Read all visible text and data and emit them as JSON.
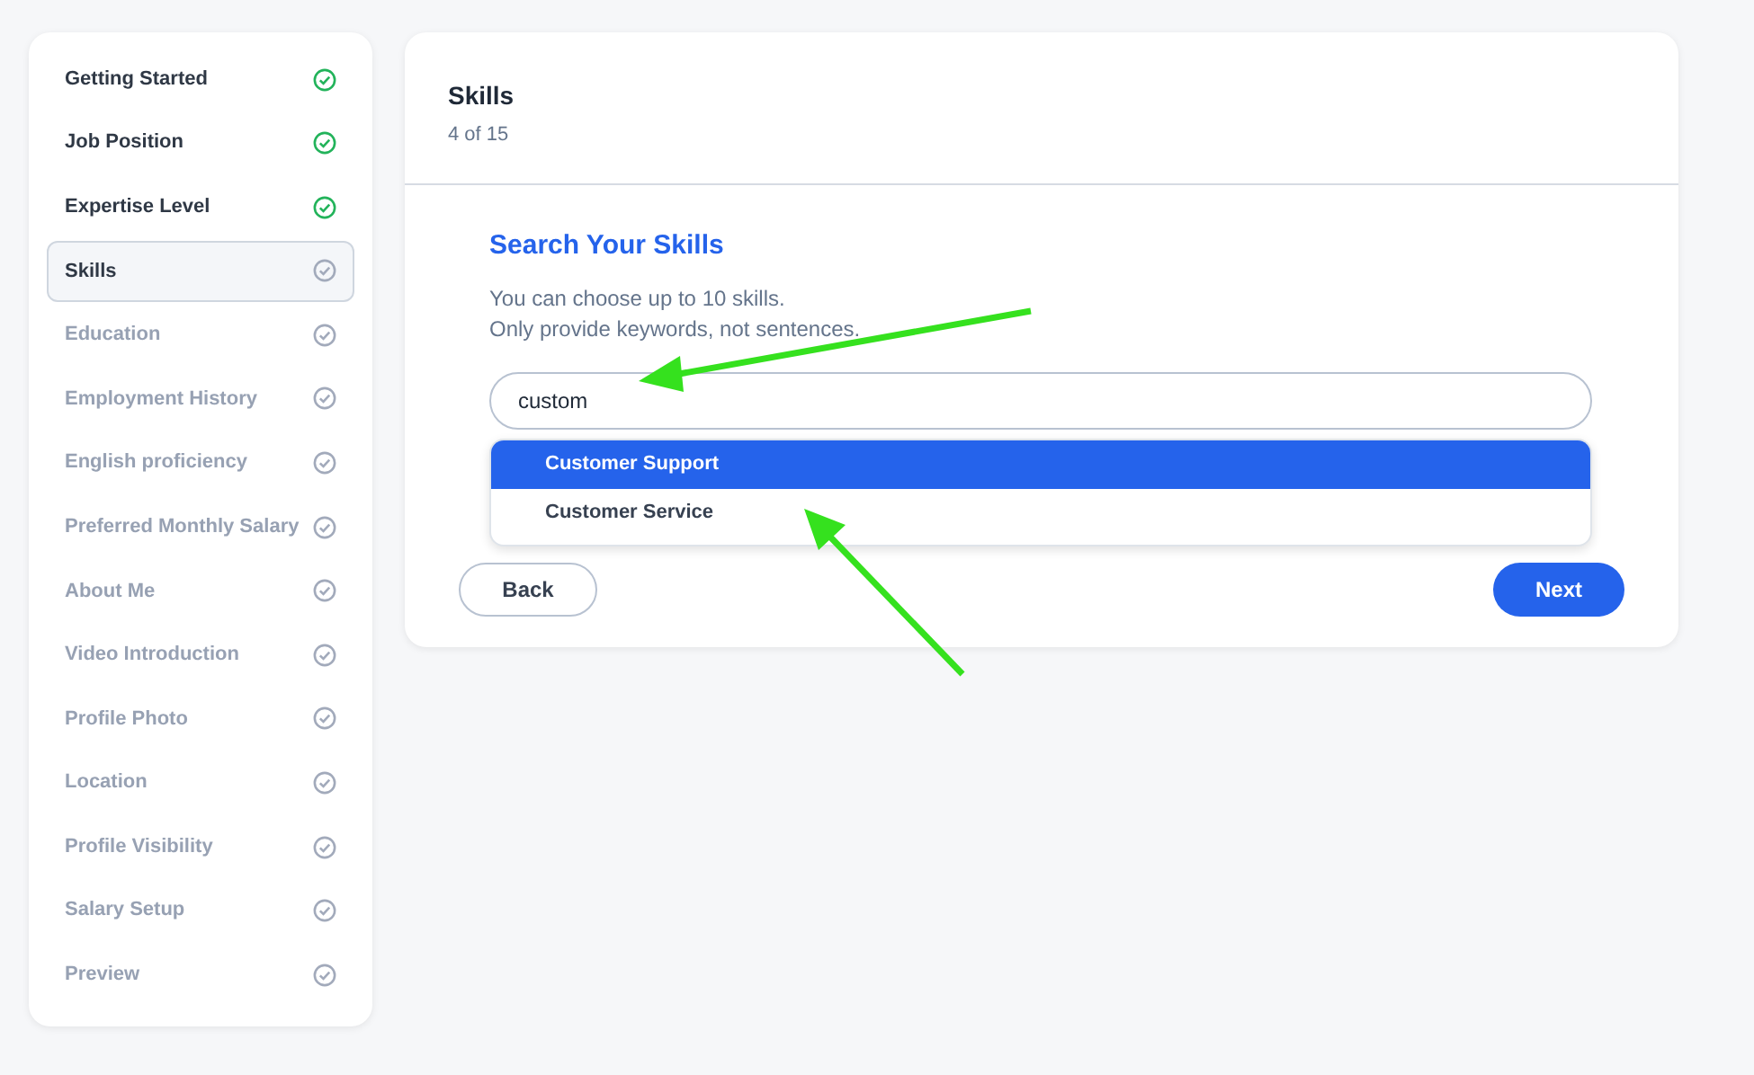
{
  "steps": [
    {
      "label": "Getting Started",
      "completed": true,
      "selected": false
    },
    {
      "label": "Job Position",
      "completed": true,
      "selected": false
    },
    {
      "label": "Expertise Level",
      "completed": true,
      "selected": false
    },
    {
      "label": "Skills",
      "completed": false,
      "selected": true
    },
    {
      "label": "Education",
      "completed": false,
      "selected": false
    },
    {
      "label": "Employment History",
      "completed": false,
      "selected": false
    },
    {
      "label": "English proficiency",
      "completed": false,
      "selected": false
    },
    {
      "label": "Preferred Monthly Salary",
      "completed": false,
      "selected": false
    },
    {
      "label": "About Me",
      "completed": false,
      "selected": false
    },
    {
      "label": "Video Introduction",
      "completed": false,
      "selected": false
    },
    {
      "label": "Profile Photo",
      "completed": false,
      "selected": false
    },
    {
      "label": "Location",
      "completed": false,
      "selected": false
    },
    {
      "label": "Profile Visibility",
      "completed": false,
      "selected": false
    },
    {
      "label": "Salary Setup",
      "completed": false,
      "selected": false
    },
    {
      "label": "Preview",
      "completed": false,
      "selected": false
    }
  ],
  "header": {
    "title": "Skills",
    "progress": "4 of 15"
  },
  "form": {
    "heading": "Search Your Skills",
    "hints": [
      "You can choose up to 10 skills.",
      "Only provide keywords, not sentences."
    ],
    "search": {
      "value": "custom"
    },
    "suggestions": [
      {
        "label": "Customer Support",
        "selected": true
      },
      {
        "label": "Customer Service",
        "selected": false
      }
    ]
  },
  "buttons": {
    "back": "Back",
    "next": "Next"
  }
}
